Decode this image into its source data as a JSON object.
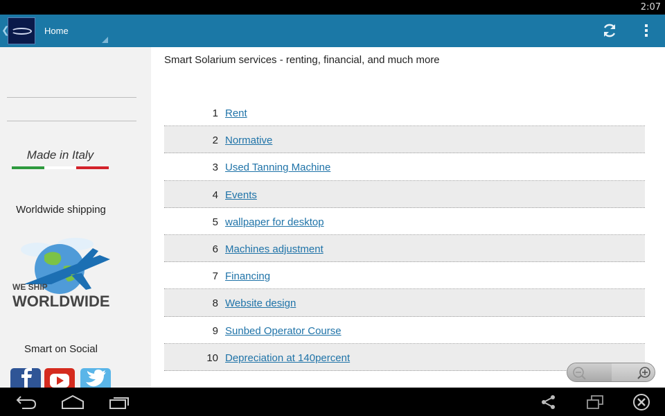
{
  "status_bar": {
    "time": "2:07"
  },
  "action_bar": {
    "title": "Home",
    "icons": {
      "logo": "smart-logo-icon",
      "refresh": "refresh-icon",
      "overflow": "overflow-menu-icon"
    }
  },
  "sidebar": {
    "made_in_italy": "Made in Italy",
    "flag_colors": [
      "#2e9a3e",
      "#ffffff",
      "#d3222a"
    ],
    "shipping_label": "Worldwide shipping",
    "ship_badge": {
      "line1": "WE SHIP",
      "line2": "WORLDWIDE"
    },
    "social_label": "Smart on Social",
    "social_icons": [
      "facebook-icon",
      "youtube-icon",
      "twitter-icon"
    ]
  },
  "main": {
    "intro": "Smart Solarium services - renting, financial, and much more",
    "items": [
      {
        "num": "1",
        "label": "Rent"
      },
      {
        "num": "2",
        "label": "Normative"
      },
      {
        "num": "3",
        "label": "Used Tanning Machine"
      },
      {
        "num": "4",
        "label": "Events"
      },
      {
        "num": "5",
        "label": "wallpaper for desktop"
      },
      {
        "num": "6",
        "label": "Machines adjustment"
      },
      {
        "num": "7",
        "label": "Financing"
      },
      {
        "num": "8",
        "label": "Website design"
      },
      {
        "num": "9",
        "label": "Sunbed Operator Course"
      },
      {
        "num": "10",
        "label": "Depreciation at 140percent"
      }
    ]
  },
  "colors": {
    "action_bar": "#1b78a6",
    "link": "#1f73a8",
    "row_shade": "#ececec"
  }
}
